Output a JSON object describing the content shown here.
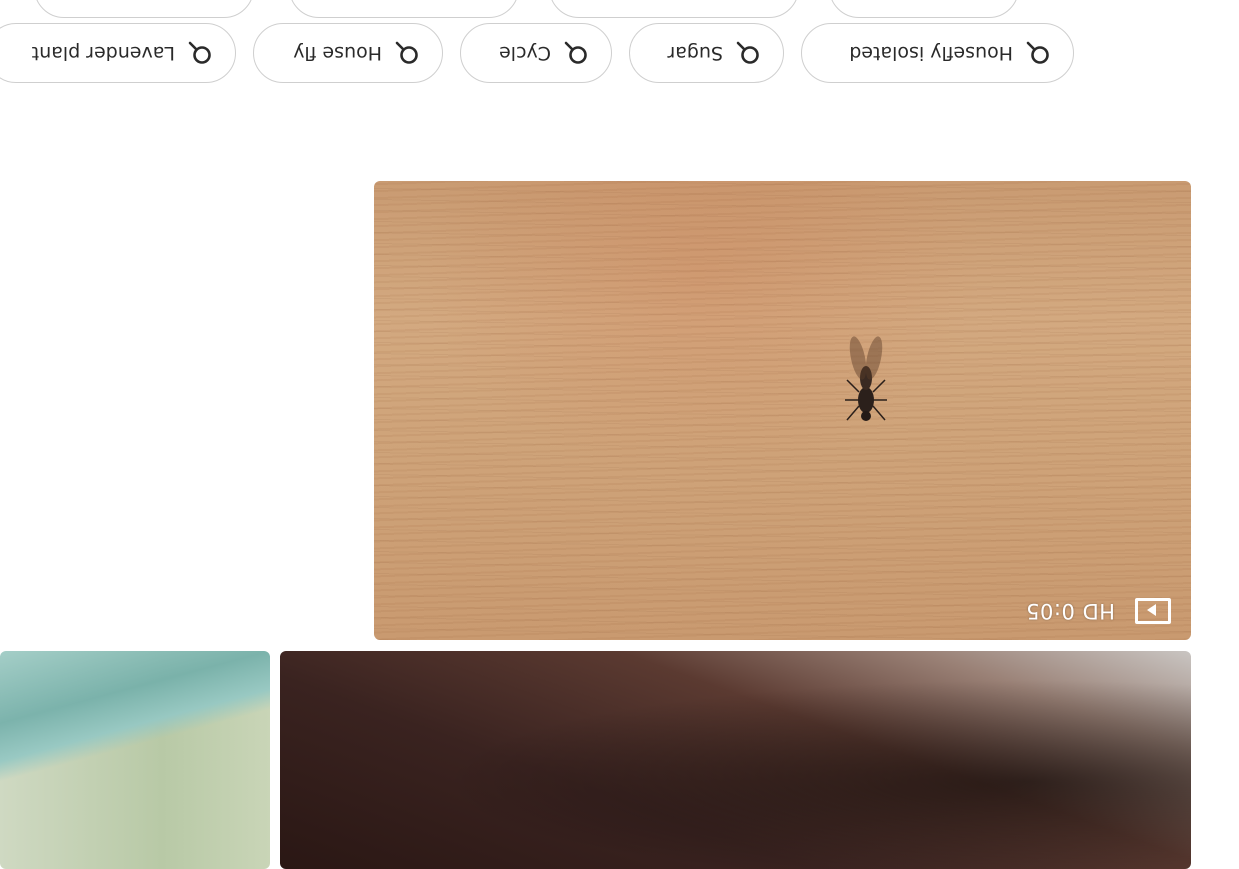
{
  "results": {
    "tiles": [
      {
        "kind": "image",
        "subject": "dark close-up"
      },
      {
        "kind": "image",
        "subject": "leaf"
      },
      {
        "kind": "video",
        "quality": "HD",
        "duration": "0:05",
        "icon": "play-icon"
      }
    ]
  },
  "related_searches": {
    "chips": [
      {
        "label": "Housefly isolated",
        "icon": "search-icon"
      },
      {
        "label": "Sugar",
        "icon": "search-icon"
      },
      {
        "label": "Cycle",
        "icon": "search-icon"
      },
      {
        "label": "House fly",
        "icon": "search-icon"
      },
      {
        "label": "Lavender plant",
        "icon": "search-icon"
      }
    ]
  },
  "colors": {
    "chip_border": "#cfcfcf",
    "chip_text": "#2a2a2a",
    "overlay_text": "#ffffff"
  }
}
